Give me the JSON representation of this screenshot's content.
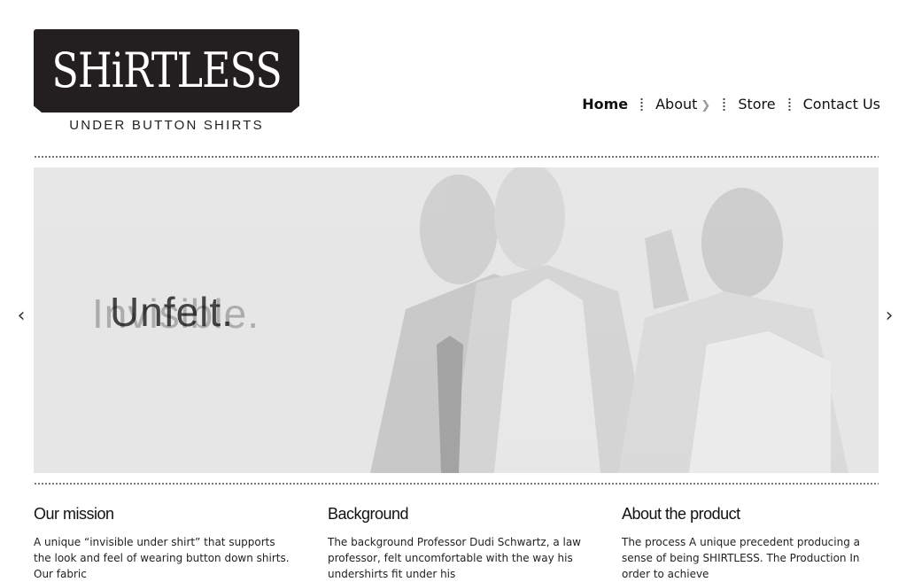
{
  "logo": {
    "wordmark": "SHiRTLESS",
    "tagline": "UNDER BUTTON SHIRTS"
  },
  "nav": [
    {
      "label": "Home",
      "active": true
    },
    {
      "label": "About",
      "has_submenu": true
    },
    {
      "label": "Store"
    },
    {
      "label": "Contact Us"
    }
  ],
  "slider": {
    "headline": "Unfelt.",
    "ghost_text": "Invisible.",
    "prev_icon": "chevron-left-icon",
    "next_icon": "chevron-right-icon"
  },
  "sections": [
    {
      "title": "Our mission",
      "text": "A unique “invisible under shirt” that supports the look and feel of wearing button down shirts. Our fabric"
    },
    {
      "title": "Background",
      "text": "The background Professor Dudi Schwartz, a law professor, felt uncomfortable with the way his undershirts fit under his"
    },
    {
      "title": "About the product",
      "text": "The process A unique precedent producing a sense of being SHIRTLESS.   The Production In order to achieve"
    }
  ]
}
